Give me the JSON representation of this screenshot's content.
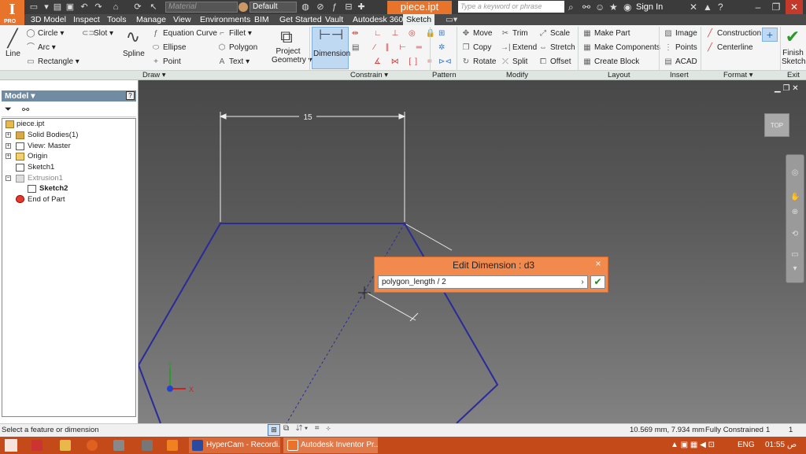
{
  "app": {
    "logo_letter": "I",
    "logo_sub": "PRO",
    "document_name": "piece.ipt",
    "material_placeholder": "Material",
    "appearance_value": "Default",
    "search_placeholder": "Type a keyword or phrase",
    "sign_in": "Sign In",
    "accent_color": "#e8732a"
  },
  "tabs": [
    "3D Model",
    "Inspect",
    "Tools",
    "Manage",
    "View",
    "Environments",
    "BIM",
    "Get Started",
    "Vault",
    "Autodesk 360",
    "Sketch"
  ],
  "ribbon": {
    "draw": {
      "line": "Line",
      "circle": "Circle",
      "arc": "Arc",
      "rectangle": "Rectangle",
      "slot": "Slot",
      "spline": "Spline",
      "equation_curve": "Equation Curve",
      "ellipse": "Ellipse",
      "point": "Point",
      "fillet": "Fillet",
      "polygon": "Polygon",
      "text": "Text",
      "project_geometry": [
        "Project",
        "Geometry"
      ]
    },
    "constrain": {
      "dimension": "Dimension"
    },
    "modify": {
      "move": "Move",
      "copy": "Copy",
      "rotate": "Rotate",
      "trim": "Trim",
      "extend": "Extend",
      "split": "Split",
      "scale": "Scale",
      "stretch": "Stretch",
      "offset": "Offset"
    },
    "layout": {
      "make_part": "Make Part",
      "make_components": "Make Components",
      "create_block": "Create Block"
    },
    "insert": {
      "image": "Image",
      "points": "Points",
      "acad": "ACAD"
    },
    "format": {
      "construction": "Construction",
      "centerline": "Centerline"
    },
    "exit": {
      "finish_sketch": [
        "Finish",
        "Sketch"
      ]
    },
    "panels": [
      "Draw",
      "Constrain",
      "Pattern",
      "Modify",
      "Layout",
      "Insert",
      "Format",
      "Exit"
    ]
  },
  "browser": {
    "title": "Model",
    "tree": [
      {
        "label": "piece.ipt"
      },
      {
        "label": "Solid Bodies(1)"
      },
      {
        "label": "View: Master"
      },
      {
        "label": "Origin"
      },
      {
        "label": "Sketch1"
      },
      {
        "label": "Extrusion1"
      },
      {
        "label": "Sketch2"
      },
      {
        "label": "End of Part"
      }
    ]
  },
  "viewport": {
    "dimension_value": "15",
    "viewcube_label": "TOP",
    "axis_x": "X",
    "axis_y": "Y"
  },
  "dialog": {
    "title": "Edit Dimension : d3",
    "input_value": "polygon_length / 2",
    "close": "×"
  },
  "status": {
    "prompt": "Select a feature or dimension",
    "coords": "10.569 mm, 7.934 mm",
    "constraint_state": "Fully Constrained",
    "count_a": "1",
    "count_b": "1"
  },
  "taskbar": {
    "items": [
      "HyperCam - Recordi...",
      "Autodesk Inventor Pr..."
    ],
    "language": "ENG",
    "time": "01:55",
    "ampm": "ص"
  }
}
